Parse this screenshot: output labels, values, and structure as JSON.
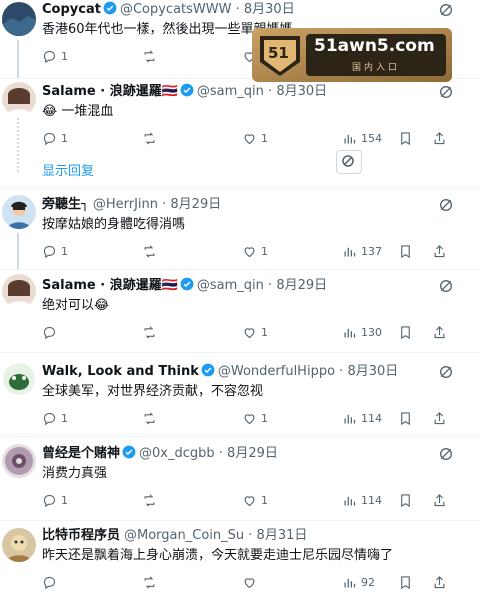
{
  "tweets": [
    {
      "name": "Copycat",
      "handle": "@CopycatsWWW",
      "date": "8月30日",
      "text": "香港60年代也一樣，然後出現一些單親媽媽",
      "replies": "1",
      "retweets": "",
      "likes": "",
      "views": ""
    },
    {
      "name": "Salame · 浪跡暹羅🇹🇭",
      "handle": "@sam_qin",
      "date": "8月30日",
      "text": "😂 一堆混血",
      "replies": "1",
      "retweets": "",
      "likes": "1",
      "views": "154"
    },
    {
      "name": "旁聽生┐",
      "handle": "@HerrJinn",
      "date": "8月29日",
      "text": "按摩姑娘的身體吃得消嗎",
      "replies": "1",
      "retweets": "",
      "likes": "1",
      "views": "137"
    },
    {
      "name": "Salame · 浪跡暹羅🇹🇭",
      "handle": "@sam_qin",
      "date": "8月29日",
      "text": "绝对可以😂",
      "replies": "",
      "retweets": "",
      "likes": "1",
      "views": "130"
    },
    {
      "name": "Walk, Look and Think",
      "handle": "@WonderfulHippo",
      "date": "8月30日",
      "text": "全球美军，对世界经济贡献，不容忽视",
      "replies": "1",
      "retweets": "",
      "likes": "1",
      "views": "114"
    },
    {
      "name": "曾经是个赌神",
      "handle": "@0x_dcgbb",
      "date": "8月29日",
      "text": "消费力真强",
      "replies": "1",
      "retweets": "",
      "likes": "1",
      "views": "114"
    },
    {
      "name": "比特币程序员",
      "handle": "@Morgan_Coin_Su",
      "date": "8月31日",
      "text": "昨天还是飘着海上身心崩溃，今天就要走迪士尼乐园尽情嗨了",
      "replies": "",
      "retweets": "",
      "likes": "",
      "views": "92"
    }
  ],
  "show_replies": "显示回复",
  "watermark": {
    "text": "51awn5.com",
    "sub": "国内入口",
    "logo": "51"
  },
  "colors": {
    "accent": "#1d9bf0",
    "muted": "#536471",
    "border": "#eff3f4",
    "verified": "#1d9bf0"
  }
}
